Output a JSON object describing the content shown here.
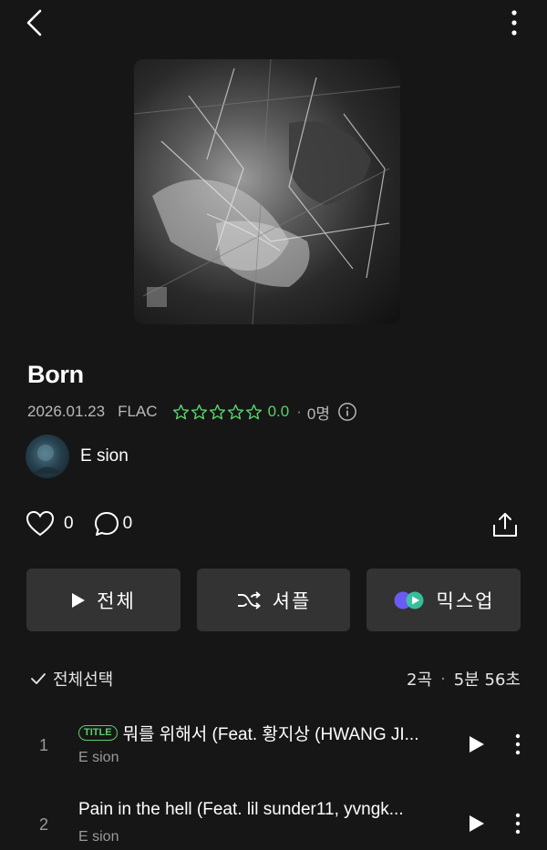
{
  "album": {
    "title": "Born",
    "date": "2026.01.23",
    "format": "FLAC",
    "rating": "0.0",
    "rating_count": "0명",
    "stars": 0
  },
  "artist": {
    "name": "E sion"
  },
  "social": {
    "likes": "0",
    "comments": "0"
  },
  "buttons": {
    "play_all": "전체",
    "shuffle": "셔플",
    "mixup": "믹스업"
  },
  "list_header": {
    "select_all": "전체선택",
    "track_count": "2곡",
    "duration": "5분 56초"
  },
  "tracks": [
    {
      "number": "1",
      "badge": "TITLE",
      "title": "뭐를 위해서 (Feat. 황지상 (HWANG JI...",
      "artist": "E sion"
    },
    {
      "number": "2",
      "title": "Pain in the hell (Feat. lil sunder11, yvngk...",
      "artist": "E sion"
    }
  ],
  "colors": {
    "background": "#161616",
    "accent_green": "#57d16a",
    "button_bg": "#333333"
  },
  "icons": [
    "back-icon",
    "more-vertical-icon",
    "star-outline-icon",
    "info-icon",
    "heart-outline-icon",
    "comment-icon",
    "share-icon",
    "play-icon",
    "shuffle-icon",
    "mixup-icon",
    "check-icon"
  ]
}
